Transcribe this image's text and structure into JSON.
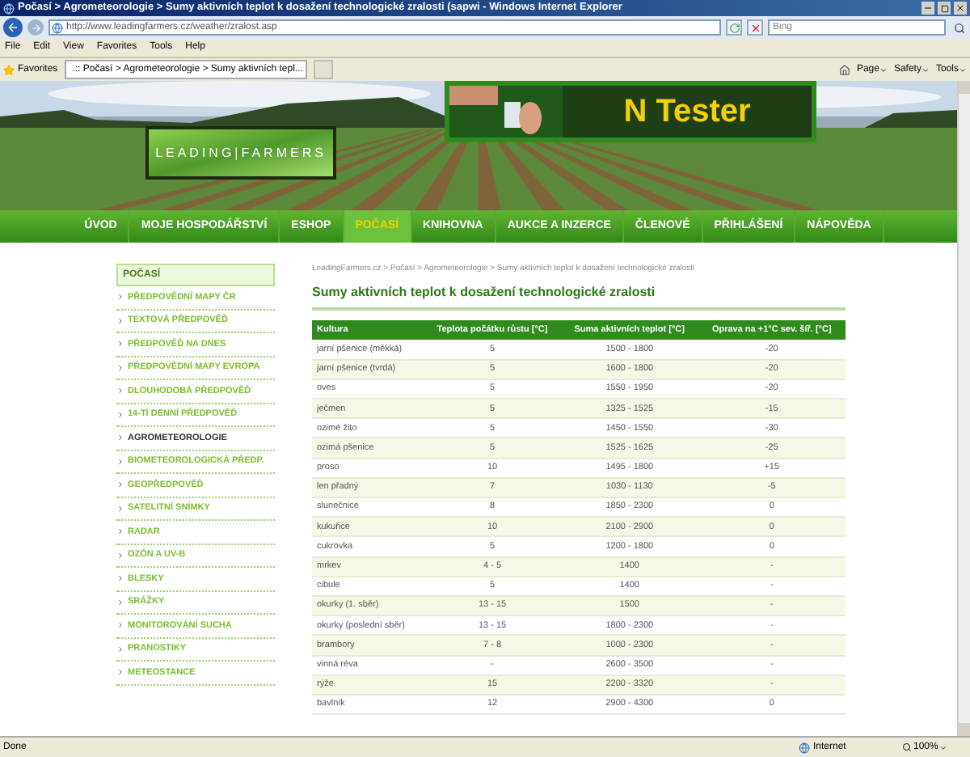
{
  "window": {
    "title": "Počasí > Agrometeorologie > Sumy aktivních teplot k dosažení technologické zralosti (sapwi - Windows Internet Explorer"
  },
  "address_bar": {
    "url": "http://www.leadingfarmers.cz/weather/zralost.asp"
  },
  "search": {
    "placeholder": "Bing"
  },
  "menu": [
    "File",
    "Edit",
    "View",
    "Favorites",
    "Tools",
    "Help"
  ],
  "favorites_bar": {
    "label": "Favorites",
    "tab": ".:: Počasí > Agrometeorologie > Sumy aktivních tepl..."
  },
  "command_bar": [
    "Page",
    "Safety",
    "Tools"
  ],
  "banner": {
    "logo": "LEADING|FARMERS",
    "ad": "N Tester"
  },
  "nav": [
    {
      "label": "ÚVOD",
      "selected": false
    },
    {
      "label": "MOJE HOSPODÁŘSTVÍ",
      "selected": false
    },
    {
      "label": "ESHOP",
      "selected": false
    },
    {
      "label": "POČASÍ",
      "selected": true
    },
    {
      "label": "KNIHOVNA",
      "selected": false
    },
    {
      "label": "AUKCE A INZERCE",
      "selected": false
    },
    {
      "label": "ČLENOVÉ",
      "selected": false
    },
    {
      "label": "PŘIHLÁŠENÍ",
      "selected": false
    },
    {
      "label": "NÁPOVĚDA",
      "selected": false
    }
  ],
  "sidebar": {
    "title": "POČASÍ",
    "items": [
      {
        "label": "PŘEDPOVĚDNÍ MAPY ČR",
        "selected": false
      },
      {
        "label": "TEXTOVÁ PŘEDPOVĚĎ",
        "selected": false
      },
      {
        "label": "PŘEDPOVĚĎ NA DNES",
        "selected": false
      },
      {
        "label": "PŘEDPOVĚDNÍ MAPY EVROPA",
        "selected": false
      },
      {
        "label": "DLOUHODOBÁ PŘEDPOVĚĎ",
        "selected": false
      },
      {
        "label": "14-TI DENNÍ PŘEDPOVĚĎ",
        "selected": false
      },
      {
        "label": "AGROMETEOROLOGIE",
        "selected": true
      },
      {
        "label": "BIOMETEOROLOGICKÁ PŘEDP.",
        "selected": false
      },
      {
        "label": "GEOPŘEDPOVĚĎ",
        "selected": false
      },
      {
        "label": "SATELITNÍ SNÍMKY",
        "selected": false
      },
      {
        "label": "RADAR",
        "selected": false
      },
      {
        "label": "OZÓN A UV-B",
        "selected": false
      },
      {
        "label": "BLESKY",
        "selected": false
      },
      {
        "label": "SRÁŽKY",
        "selected": false
      },
      {
        "label": "MONITOROVÁNÍ SUCHA",
        "selected": false
      },
      {
        "label": "PRANOSTIKY",
        "selected": false
      },
      {
        "label": "METEOSTANCE",
        "selected": false
      }
    ]
  },
  "breadcrumb": "LeadingFarmers.cz > Počasí > Agrometeorologie > Sumy aktivních teplot k dosažení technologické zralosti",
  "heading": "Sumy aktivních teplot k dosažení technologické zralosti",
  "table": {
    "columns": [
      "Kultura",
      "Teplota počátku růstu [°C]",
      "Suma aktivních teplot [°C]",
      "Oprava na +1°C sev. šíř. [°C]"
    ],
    "rows": [
      [
        "jarní pšenice (měkká)",
        "5",
        "1500 - 1800",
        "-20"
      ],
      [
        "jarní pšenice (tvrdá)",
        "5",
        "1600 - 1800",
        "-20"
      ],
      [
        "oves",
        "5",
        "1550 - 1950",
        "-20"
      ],
      [
        "ječmen",
        "5",
        "1325 - 1525",
        "-15"
      ],
      [
        "ozimé žito",
        "5",
        "1450 - 1550",
        "-30"
      ],
      [
        "ozimá pšenice",
        "5",
        "1525 - 1625",
        "-25"
      ],
      [
        "proso",
        "10",
        "1495 - 1800",
        "+15"
      ],
      [
        "len přadný",
        "7",
        "1030 - 1130",
        "-5"
      ],
      [
        "slunečnice",
        "8",
        "1850 - 2300",
        "0"
      ],
      [
        "kukuřice",
        "10",
        "2100 - 2900",
        "0"
      ],
      [
        "cukrovka",
        "5",
        "1200 - 1800",
        "0"
      ],
      [
        "mrkev",
        "4 - 5",
        "1400",
        "-"
      ],
      [
        "cibule",
        "5",
        "1400",
        "-"
      ],
      [
        "okurky (1. sběr)",
        "13 - 15",
        "1500",
        "-"
      ],
      [
        "okurky (poslední sběr)",
        "13 - 15",
        "1800 - 2300",
        "-"
      ],
      [
        "brambory",
        "7 - 8",
        "1000 - 2300",
        "-"
      ],
      [
        "vinná réva",
        "-",
        "2600 - 3500",
        "-"
      ],
      [
        "rýže",
        "15",
        "2200 - 3320",
        "-"
      ],
      [
        "bavlník",
        "12",
        "2900 - 4300",
        "0"
      ]
    ]
  },
  "status_bar": {
    "text": "Done",
    "zone": "Internet",
    "zoom": "100%"
  }
}
